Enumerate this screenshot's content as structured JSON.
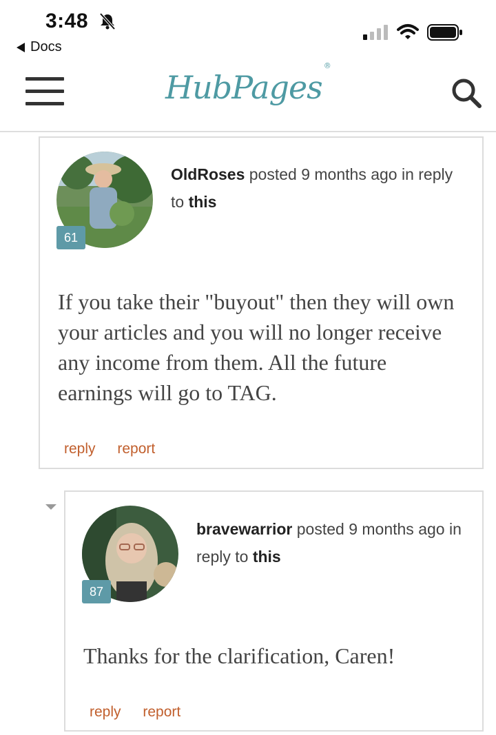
{
  "status_bar": {
    "time": "3:48",
    "back_label": "Docs"
  },
  "header": {
    "logo_text": "HubPages",
    "logo_mark": "®"
  },
  "colors": {
    "brand": "#4e9aa3",
    "action": "#c15f2d",
    "badge": "#5e9aa7"
  },
  "comments": [
    {
      "author": "OldRoses",
      "posted": "posted 9 months ago in reply to",
      "link": "this",
      "badge": "61",
      "body": "If you take their \"buyout\" then they will own your articles and you will no longer receive any income from them.  All the future earnings will go to TAG.",
      "actions": [
        "reply",
        "report"
      ]
    },
    {
      "author": "bravewarrior",
      "posted": "posted 9 months ago in reply to",
      "link": "this",
      "badge": "87",
      "body": "Thanks for the clarification, Caren!",
      "actions": [
        "reply",
        "report"
      ]
    }
  ]
}
